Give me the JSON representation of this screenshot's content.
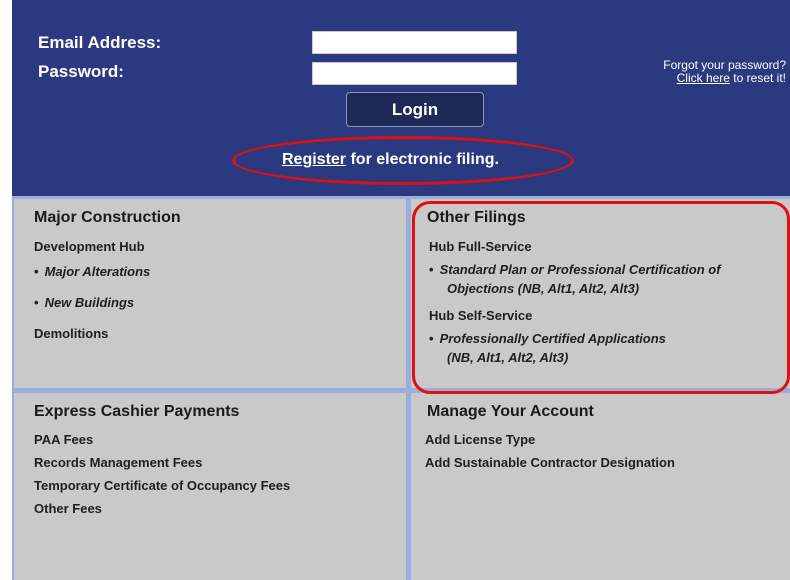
{
  "login": {
    "email_label": "Email Address:",
    "password_label": "Password:",
    "email_value": "",
    "password_value": "",
    "login_button": "Login",
    "forgot_line1": "Forgot your password?",
    "forgot_link": "Click here",
    "forgot_suffix": " to reset it!",
    "register_link": "Register",
    "register_suffix": " for electronic filing."
  },
  "major_construction": {
    "title": "Major Construction",
    "hub": "Development Hub",
    "items": [
      "Major Alterations",
      "New Buildings"
    ],
    "demolitions": "Demolitions"
  },
  "other_filings": {
    "title": "Other Filings",
    "full_service": "Hub Full-Service",
    "full_service_item_line1": "Standard Plan or Professional Certification of",
    "full_service_item_line2": "Objections (NB, Alt1, Alt2, Alt3)",
    "self_service": "Hub Self-Service",
    "self_service_item_line1": "Professionally Certified Applications",
    "self_service_item_line2": "(NB, Alt1, Alt2, Alt3)"
  },
  "express_cashier": {
    "title": "Express Cashier Payments",
    "items": [
      "PAA Fees",
      "Records Management Fees",
      "Temporary Certificate of Occupancy Fees",
      "Other Fees"
    ]
  },
  "manage_account": {
    "title": "Manage Your Account",
    "items": [
      "Add License Type",
      "Add Sustainable Contractor Designation"
    ]
  },
  "colors": {
    "header_bg": "#2b3a80",
    "cell_bg": "#c9c9c9",
    "divider": "#9aaede",
    "highlight": "#e01010"
  }
}
